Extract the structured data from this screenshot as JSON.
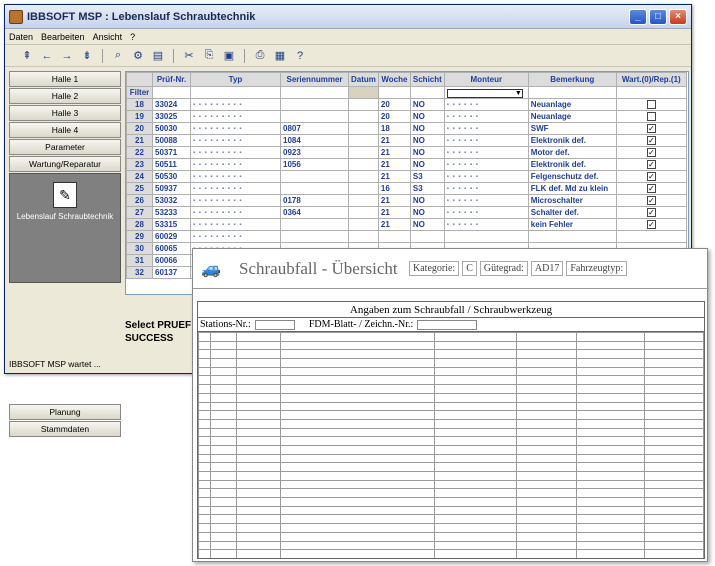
{
  "window": {
    "title": "IBBSOFT MSP : Lebenslauf Schraubtechnik",
    "status": "IBBSOFT MSP wartet ..."
  },
  "menu": [
    "Daten",
    "Bearbeiten",
    "Ansicht",
    "?"
  ],
  "sidebar": {
    "top_items": [
      "Halle 1",
      "Halle 2",
      "Halle 3",
      "Halle 4",
      "Parameter",
      "Wartung/Reparatur"
    ],
    "active_panel": "Lebenslauf Schraubtechnik",
    "bottom_items": [
      "Planung",
      "Stammdaten"
    ]
  },
  "grid": {
    "columns": [
      "Prüf-Nr.",
      "Typ",
      "Seriennummer",
      "Datum",
      "Woche",
      "Schicht",
      "Monteur",
      "Bemerkung",
      "Wart.(0)/Rep.(1)"
    ],
    "filter_label": "Filter",
    "rows": [
      {
        "n": "18",
        "pn": "33024",
        "sn": "",
        "w": "20",
        "s": "NO",
        "bem": "Neuanlage",
        "chk": ""
      },
      {
        "n": "19",
        "pn": "33025",
        "sn": "",
        "w": "20",
        "s": "NO",
        "bem": "Neuanlage",
        "chk": ""
      },
      {
        "n": "20",
        "pn": "50030",
        "sn": "0807",
        "w": "18",
        "s": "NO",
        "bem": "SWF",
        "chk": "✓"
      },
      {
        "n": "21",
        "pn": "50088",
        "sn": "1084",
        "w": "21",
        "s": "NO",
        "bem": "Elektronik def.",
        "chk": "✓"
      },
      {
        "n": "22",
        "pn": "50371",
        "sn": "0923",
        "w": "21",
        "s": "NO",
        "bem": "Motor def.",
        "chk": "✓"
      },
      {
        "n": "23",
        "pn": "50511",
        "sn": "1056",
        "w": "21",
        "s": "NO",
        "bem": "Elektronik def.",
        "chk": "✓"
      },
      {
        "n": "24",
        "pn": "50530",
        "sn": "",
        "w": "21",
        "s": "S3",
        "bem": "Felgenschutz def.",
        "chk": "✓"
      },
      {
        "n": "25",
        "pn": "50937",
        "sn": "",
        "w": "16",
        "s": "S3",
        "bem": "FLK def. Md zu klein",
        "chk": "✓"
      },
      {
        "n": "26",
        "pn": "53032",
        "sn": "0178",
        "w": "21",
        "s": "NO",
        "bem": "Microschalter",
        "chk": "✓"
      },
      {
        "n": "27",
        "pn": "53233",
        "sn": "0364",
        "w": "21",
        "s": "NO",
        "bem": "Schalter def.",
        "chk": "✓"
      },
      {
        "n": "28",
        "pn": "53315",
        "sn": "",
        "w": "21",
        "s": "NO",
        "bem": "kein Fehler",
        "chk": "✓"
      },
      {
        "n": "29",
        "pn": "60029",
        "sn": "",
        "w": "",
        "s": "",
        "bem": "",
        "chk": ""
      },
      {
        "n": "30",
        "pn": "60065",
        "sn": "",
        "w": "",
        "s": "",
        "bem": "",
        "chk": ""
      },
      {
        "n": "31",
        "pn": "60066",
        "sn": "",
        "w": "",
        "s": "",
        "bem": "",
        "chk": ""
      },
      {
        "n": "32",
        "pn": "60137",
        "sn": "",
        "w": "",
        "s": "",
        "bem": "",
        "chk": ""
      }
    ]
  },
  "sql": {
    "line1": "Select PRUEF",
    "line2": "SUCCESS"
  },
  "report": {
    "title": "Schraubfall - Übersicht",
    "kategorie": "Kategorie:",
    "kategorie_val": "C",
    "guetegrad": "Gütegrad:",
    "guetegrad_val": "AD17",
    "fahrzeugtyp": "Fahrzeugtyp:",
    "caption": "Angaben zum Schraubfall / Schraubwerkzeug",
    "stations": "Stations-Nr.:",
    "fdm": "FDM-Blatt- / Zeichn.-Nr.:"
  }
}
